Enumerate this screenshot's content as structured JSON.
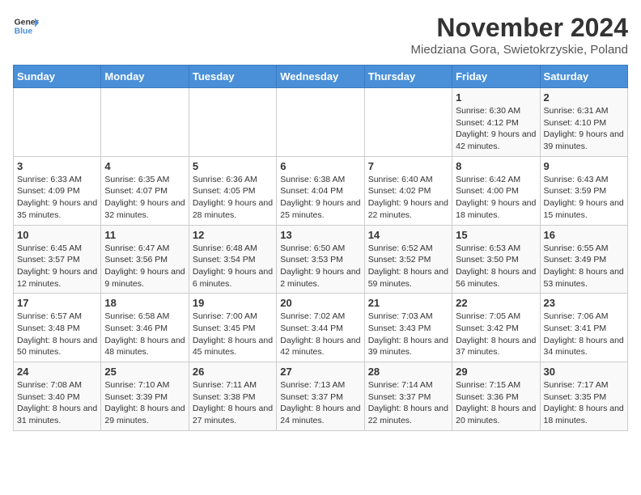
{
  "logo": {
    "line1": "General",
    "line2": "Blue"
  },
  "title": "November 2024",
  "location": "Miedziana Gora, Swietokrzyskie, Poland",
  "days_of_week": [
    "Sunday",
    "Monday",
    "Tuesday",
    "Wednesday",
    "Thursday",
    "Friday",
    "Saturday"
  ],
  "weeks": [
    [
      {
        "day": "",
        "info": ""
      },
      {
        "day": "",
        "info": ""
      },
      {
        "day": "",
        "info": ""
      },
      {
        "day": "",
        "info": ""
      },
      {
        "day": "",
        "info": ""
      },
      {
        "day": "1",
        "info": "Sunrise: 6:30 AM\nSunset: 4:12 PM\nDaylight: 9 hours and 42 minutes."
      },
      {
        "day": "2",
        "info": "Sunrise: 6:31 AM\nSunset: 4:10 PM\nDaylight: 9 hours and 39 minutes."
      }
    ],
    [
      {
        "day": "3",
        "info": "Sunrise: 6:33 AM\nSunset: 4:09 PM\nDaylight: 9 hours and 35 minutes."
      },
      {
        "day": "4",
        "info": "Sunrise: 6:35 AM\nSunset: 4:07 PM\nDaylight: 9 hours and 32 minutes."
      },
      {
        "day": "5",
        "info": "Sunrise: 6:36 AM\nSunset: 4:05 PM\nDaylight: 9 hours and 28 minutes."
      },
      {
        "day": "6",
        "info": "Sunrise: 6:38 AM\nSunset: 4:04 PM\nDaylight: 9 hours and 25 minutes."
      },
      {
        "day": "7",
        "info": "Sunrise: 6:40 AM\nSunset: 4:02 PM\nDaylight: 9 hours and 22 minutes."
      },
      {
        "day": "8",
        "info": "Sunrise: 6:42 AM\nSunset: 4:00 PM\nDaylight: 9 hours and 18 minutes."
      },
      {
        "day": "9",
        "info": "Sunrise: 6:43 AM\nSunset: 3:59 PM\nDaylight: 9 hours and 15 minutes."
      }
    ],
    [
      {
        "day": "10",
        "info": "Sunrise: 6:45 AM\nSunset: 3:57 PM\nDaylight: 9 hours and 12 minutes."
      },
      {
        "day": "11",
        "info": "Sunrise: 6:47 AM\nSunset: 3:56 PM\nDaylight: 9 hours and 9 minutes."
      },
      {
        "day": "12",
        "info": "Sunrise: 6:48 AM\nSunset: 3:54 PM\nDaylight: 9 hours and 6 minutes."
      },
      {
        "day": "13",
        "info": "Sunrise: 6:50 AM\nSunset: 3:53 PM\nDaylight: 9 hours and 2 minutes."
      },
      {
        "day": "14",
        "info": "Sunrise: 6:52 AM\nSunset: 3:52 PM\nDaylight: 8 hours and 59 minutes."
      },
      {
        "day": "15",
        "info": "Sunrise: 6:53 AM\nSunset: 3:50 PM\nDaylight: 8 hours and 56 minutes."
      },
      {
        "day": "16",
        "info": "Sunrise: 6:55 AM\nSunset: 3:49 PM\nDaylight: 8 hours and 53 minutes."
      }
    ],
    [
      {
        "day": "17",
        "info": "Sunrise: 6:57 AM\nSunset: 3:48 PM\nDaylight: 8 hours and 50 minutes."
      },
      {
        "day": "18",
        "info": "Sunrise: 6:58 AM\nSunset: 3:46 PM\nDaylight: 8 hours and 48 minutes."
      },
      {
        "day": "19",
        "info": "Sunrise: 7:00 AM\nSunset: 3:45 PM\nDaylight: 8 hours and 45 minutes."
      },
      {
        "day": "20",
        "info": "Sunrise: 7:02 AM\nSunset: 3:44 PM\nDaylight: 8 hours and 42 minutes."
      },
      {
        "day": "21",
        "info": "Sunrise: 7:03 AM\nSunset: 3:43 PM\nDaylight: 8 hours and 39 minutes."
      },
      {
        "day": "22",
        "info": "Sunrise: 7:05 AM\nSunset: 3:42 PM\nDaylight: 8 hours and 37 minutes."
      },
      {
        "day": "23",
        "info": "Sunrise: 7:06 AM\nSunset: 3:41 PM\nDaylight: 8 hours and 34 minutes."
      }
    ],
    [
      {
        "day": "24",
        "info": "Sunrise: 7:08 AM\nSunset: 3:40 PM\nDaylight: 8 hours and 31 minutes."
      },
      {
        "day": "25",
        "info": "Sunrise: 7:10 AM\nSunset: 3:39 PM\nDaylight: 8 hours and 29 minutes."
      },
      {
        "day": "26",
        "info": "Sunrise: 7:11 AM\nSunset: 3:38 PM\nDaylight: 8 hours and 27 minutes."
      },
      {
        "day": "27",
        "info": "Sunrise: 7:13 AM\nSunset: 3:37 PM\nDaylight: 8 hours and 24 minutes."
      },
      {
        "day": "28",
        "info": "Sunrise: 7:14 AM\nSunset: 3:37 PM\nDaylight: 8 hours and 22 minutes."
      },
      {
        "day": "29",
        "info": "Sunrise: 7:15 AM\nSunset: 3:36 PM\nDaylight: 8 hours and 20 minutes."
      },
      {
        "day": "30",
        "info": "Sunrise: 7:17 AM\nSunset: 3:35 PM\nDaylight: 8 hours and 18 minutes."
      }
    ]
  ]
}
